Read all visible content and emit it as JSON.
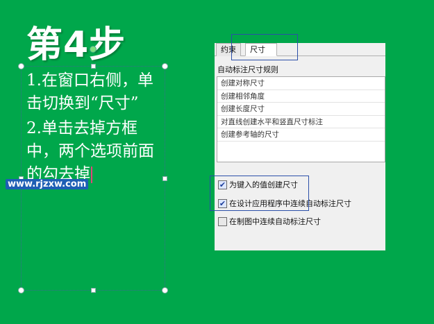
{
  "slide": {
    "title": "第4步",
    "step1": "1.在窗口右侧，单击切换到“尺寸”",
    "step2": "2.单击去掉方框中，两个选项前面的勾去掉",
    "watermark": "www.rjzxw.com"
  },
  "dialog": {
    "tabs": [
      {
        "label": "约束",
        "selected": false
      },
      {
        "label": "尺寸",
        "selected": true
      }
    ],
    "rules_header": "自动标注尺寸规则",
    "rules": [
      "创建对称尺寸",
      "创建相邻角度",
      "创建长度尺寸",
      "对直线创建水平和竖直尺寸标注",
      "创建参考轴的尺寸"
    ],
    "checkboxes": [
      {
        "label": "为键入的值创建尺寸",
        "checked": true
      },
      {
        "label": "在设计应用程序中连续自动标注尺寸",
        "checked": true
      },
      {
        "label": "在制图中连续自动标注尺寸",
        "checked": false
      }
    ]
  },
  "colors": {
    "background": "#00a74b",
    "highlight": "#2b4fa8",
    "watermark_bg": "#1e5fb4"
  }
}
